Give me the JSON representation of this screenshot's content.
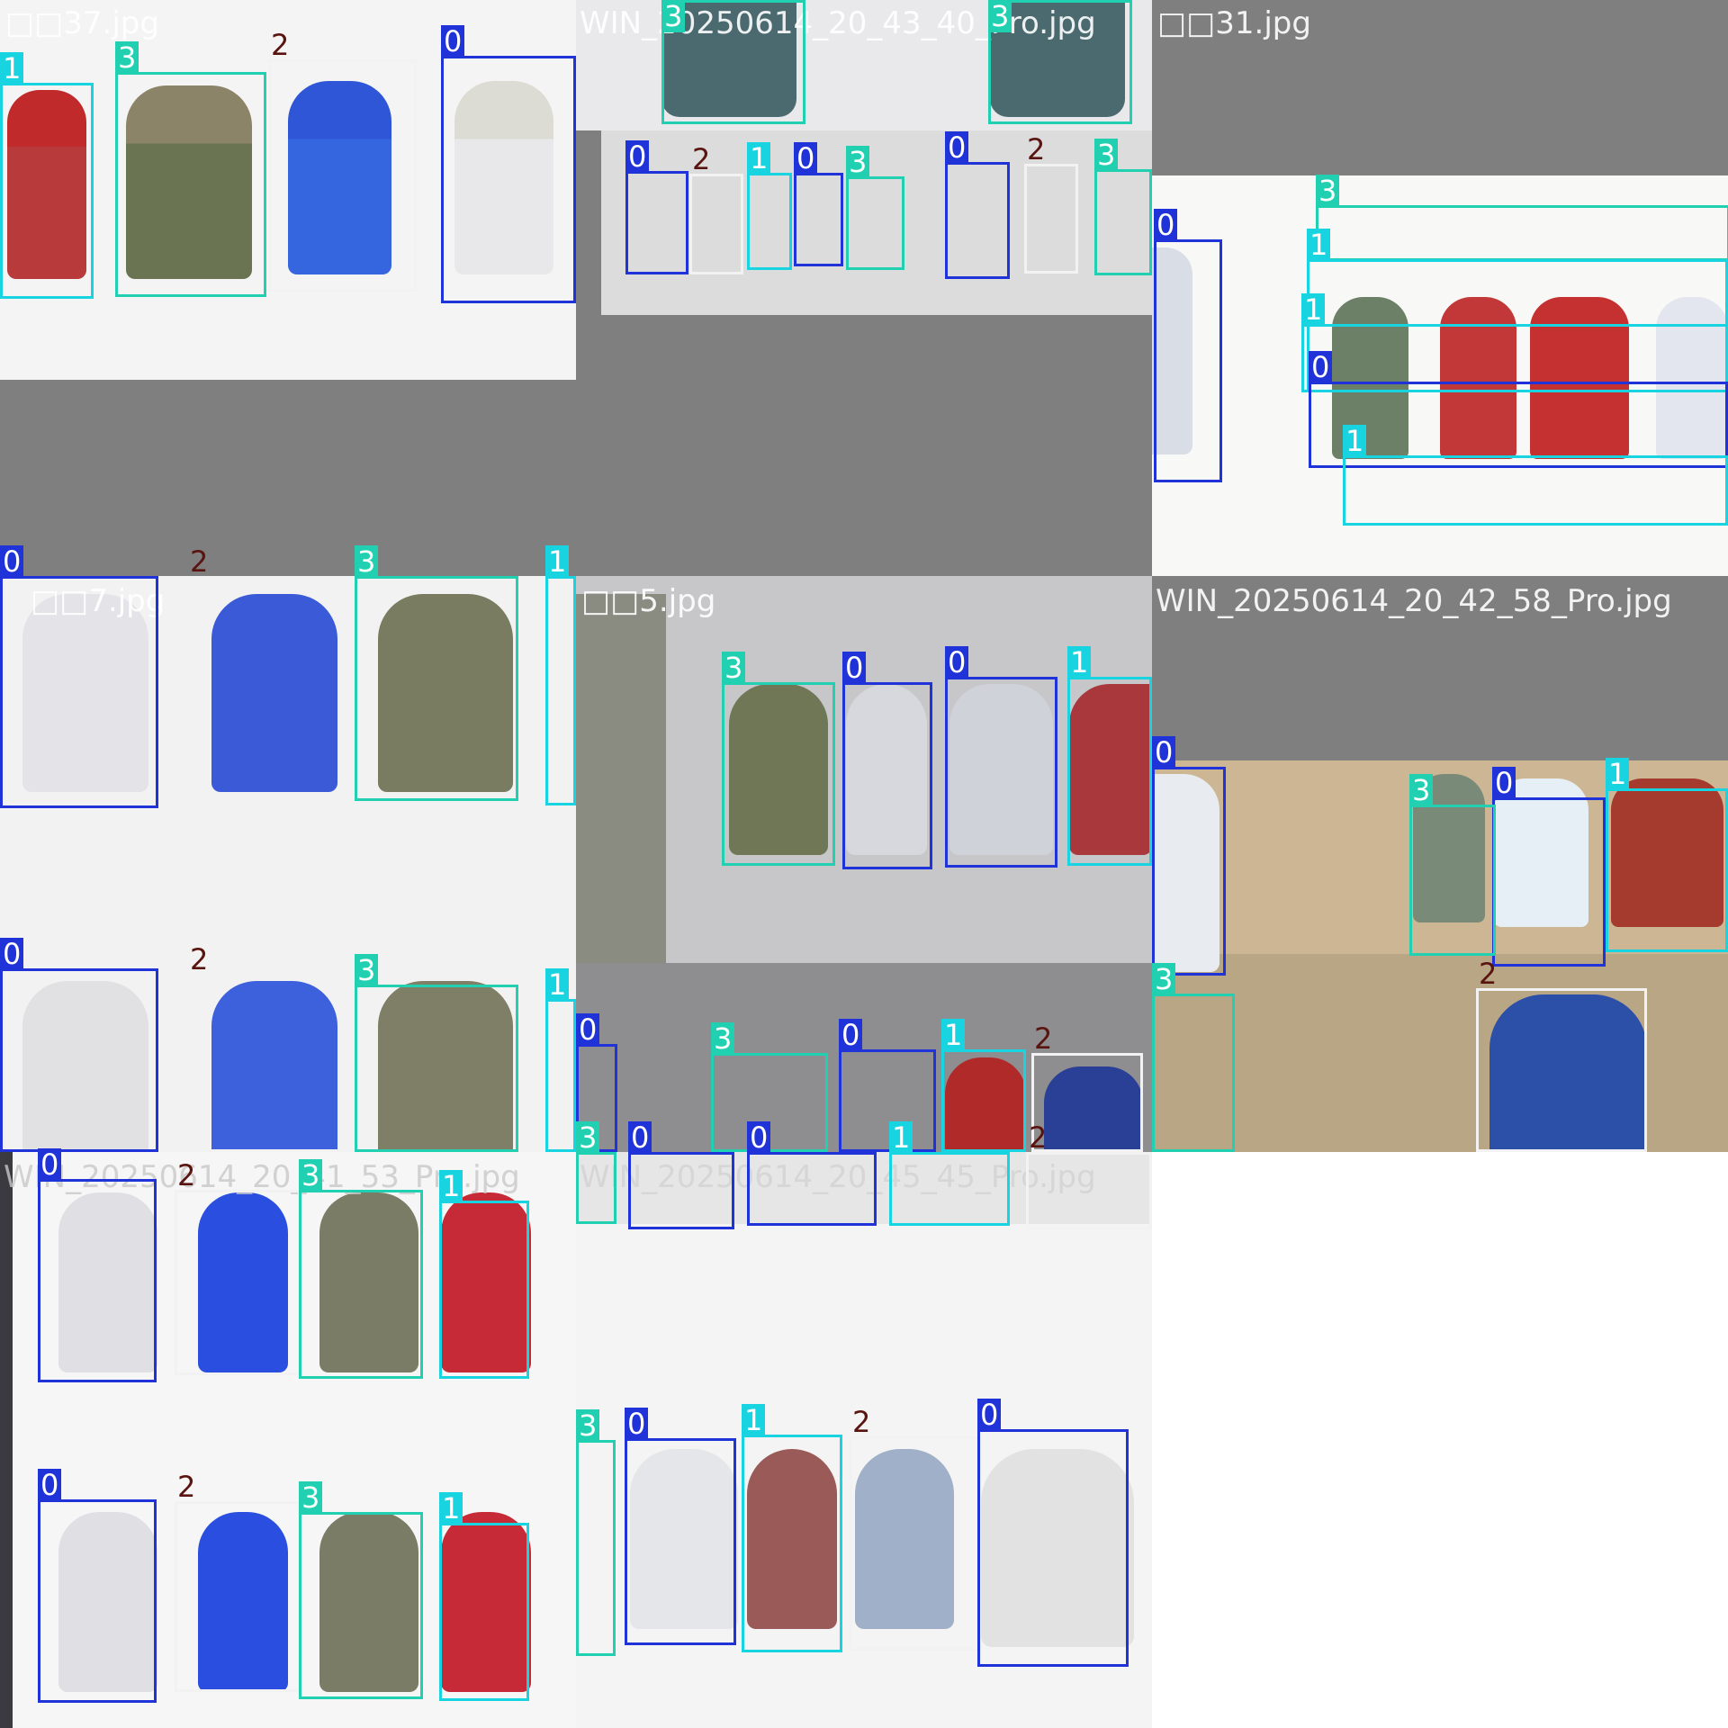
{
  "colors": {
    "0": "#1f33d9",
    "1": "#18d3e0",
    "2": "#f2f2f2",
    "3": "#20d0b0",
    "tag_text": "#ffffff",
    "tag2_text": "#5a1410",
    "gray_pad": "#7f7f7f"
  },
  "tiles": [
    {
      "name": "□□37.jpg",
      "labels": [
        "1",
        "3",
        "2",
        "0"
      ]
    },
    {
      "name": "WIN_20250614_20_43_40_Pro.jpg",
      "labels": [
        "3",
        "3",
        "0",
        "2",
        "1",
        "0",
        "3",
        "0",
        "2",
        "3"
      ]
    },
    {
      "name": "□□31.jpg",
      "labels": [
        "3",
        "1",
        "1",
        "0",
        "0",
        "1"
      ]
    },
    {
      "name": "□□7.jpg",
      "labels": [
        "0",
        "2",
        "3",
        "1",
        "0",
        "2",
        "3",
        "1"
      ]
    },
    {
      "name": "□□5.jpg",
      "labels": [
        "3",
        "0",
        "0",
        "1",
        "0",
        "3",
        "0",
        "1",
        "2",
        "3",
        "0",
        "0",
        "1",
        "2"
      ]
    },
    {
      "name": "WIN_20250614_20_42_58_Pro.jpg",
      "labels": [
        "0",
        "3",
        "0",
        "1",
        "3",
        "2"
      ]
    },
    {
      "name": "WIN_20250614_20_41_53_Pro.jpg",
      "labels": [
        "0",
        "2",
        "3",
        "1",
        "0",
        "2",
        "3",
        "1"
      ]
    },
    {
      "name": "WIN_20250614_20_45_45_Pro.jpg",
      "labels": [
        "3",
        "0",
        "1",
        "2",
        "0"
      ]
    }
  ]
}
